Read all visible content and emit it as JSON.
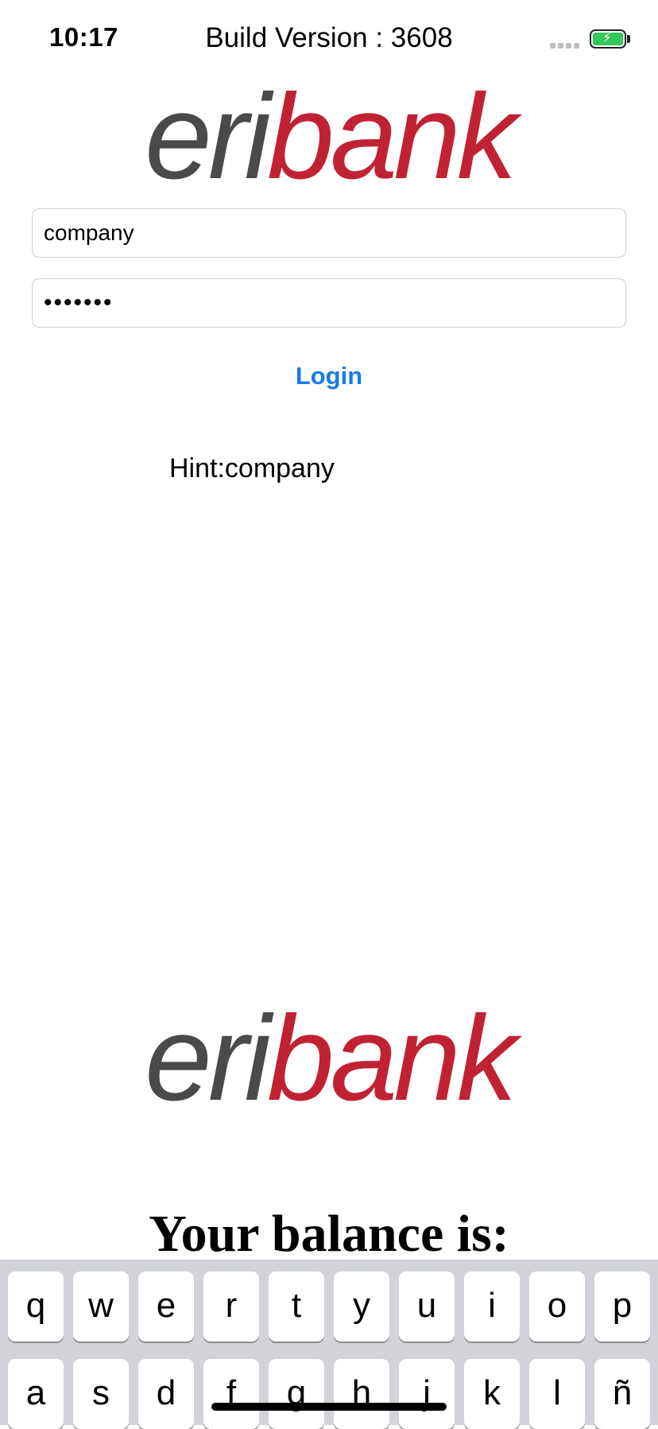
{
  "status_bar": {
    "time": "10:17",
    "title": "Build Version : 3608",
    "battery_color": "#34c759",
    "battery_icon": "battery-charging-icon",
    "signal_icon": "cellular-signal-icon"
  },
  "logo": {
    "part1": "eri",
    "part2": "bank",
    "color_part1": "#4a4a4c",
    "color_part2": "#c02234"
  },
  "login_form": {
    "username_value": "company",
    "password_value": "•••••••",
    "login_label": "Login",
    "hint_text": "Hint:company",
    "accent_color": "#1a7ce5"
  },
  "balance": {
    "title": "Your balance is:"
  },
  "keyboard": {
    "row1": [
      "q",
      "w",
      "e",
      "r",
      "t",
      "y",
      "u",
      "i",
      "o",
      "p"
    ],
    "row2": [
      "a",
      "s",
      "d",
      "f",
      "g",
      "h",
      "j",
      "k",
      "l",
      "ñ"
    ]
  }
}
